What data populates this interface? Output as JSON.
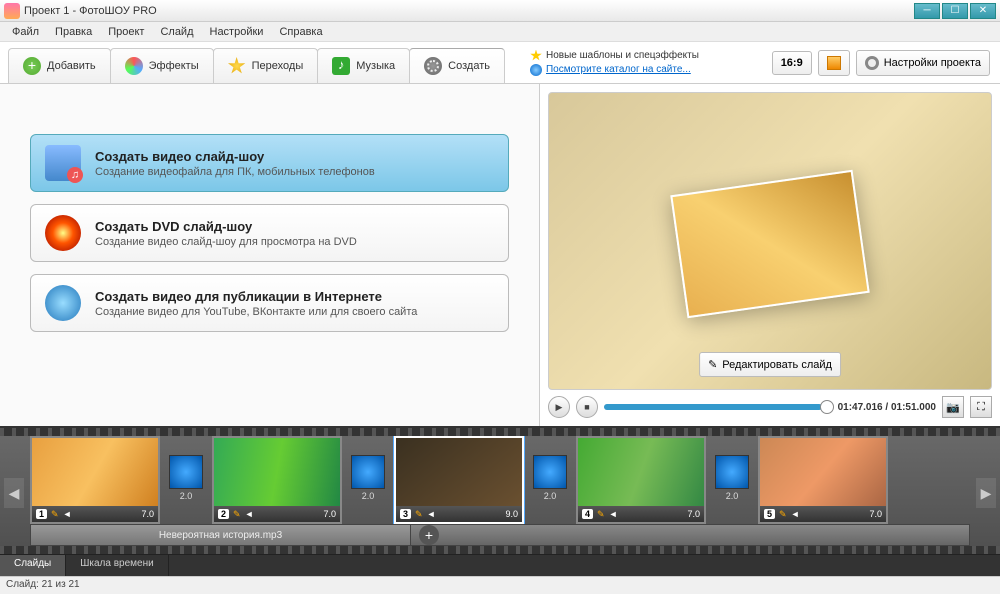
{
  "window": {
    "title": "Проект 1 - ФотоШОУ PRO"
  },
  "menu": [
    "Файл",
    "Правка",
    "Проект",
    "Слайд",
    "Настройки",
    "Справка"
  ],
  "tabs": [
    {
      "label": "Добавить",
      "icon": "add"
    },
    {
      "label": "Эффекты",
      "icon": "fx"
    },
    {
      "label": "Переходы",
      "icon": "star"
    },
    {
      "label": "Музыка",
      "icon": "music"
    },
    {
      "label": "Создать",
      "icon": "create",
      "active": true
    }
  ],
  "notice": {
    "templates": "Новые шаблоны и спецэффекты",
    "catalog": "Посмотрите каталог на сайте..."
  },
  "aspect": "16:9",
  "settings_btn": "Настройки проекта",
  "options": [
    {
      "title": "Создать видео слайд-шоу",
      "desc": "Создание видеофайла для ПК, мобильных телефонов",
      "icon": "video",
      "sel": true
    },
    {
      "title": "Создать DVD слайд-шоу",
      "desc": "Создание видео слайд-шоу для просмотра на DVD",
      "icon": "dvd"
    },
    {
      "title": "Создать видео для публикации в Интернете",
      "desc": "Создание видео для YouTube, ВКонтакте или для своего сайта",
      "icon": "web"
    }
  ],
  "preview": {
    "edit_btn": "Редактировать слайд",
    "time": "01:47.016 / 01:51.000"
  },
  "slides": [
    {
      "n": "1",
      "dur": "7.0",
      "img": "si1"
    },
    {
      "n": "2",
      "dur": "7.0",
      "img": "si2"
    },
    {
      "n": "3",
      "dur": "9.0",
      "img": "si3",
      "sel": true
    },
    {
      "n": "4",
      "dur": "7.0",
      "img": "si4"
    },
    {
      "n": "5",
      "dur": "7.0",
      "img": "si5"
    }
  ],
  "trans_dur": "2.0",
  "audio": {
    "track": "Невероятная история.mp3"
  },
  "view_tabs": [
    "Слайды",
    "Шкала времени"
  ],
  "status": "Слайд: 21 из 21"
}
